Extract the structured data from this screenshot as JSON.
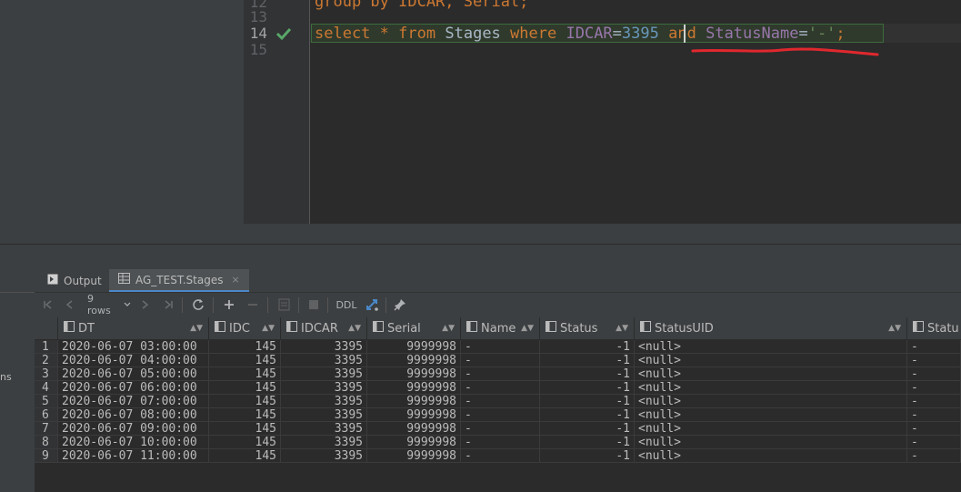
{
  "editor": {
    "line_numbers": [
      "12",
      "13",
      "14",
      "15"
    ],
    "line12_text": "group by IDCAR, Serial;",
    "line14": {
      "kw_select": "select",
      "star": "*",
      "kw_from": "from",
      "table": "Stages",
      "kw_where": "where",
      "col1": "IDCAR",
      "eq1": "=",
      "val1": "3395",
      "kw_and": "and",
      "col2": "StatusName",
      "eq2": "=",
      "val2": "'-'",
      "semi": ";"
    },
    "status_icon": "checkmark-icon",
    "annotation_color": "#e0282e"
  },
  "panel": {
    "tabs": [
      {
        "label": "Output",
        "icon": "output-icon"
      },
      {
        "label": "AG_TEST.Stages",
        "icon": "table-icon",
        "close": "×"
      }
    ],
    "left_partial_text": "ns"
  },
  "toolbar": {
    "rows_label": "9 rows",
    "ddl_label": "DDL"
  },
  "grid": {
    "columns": [
      "DT",
      "IDC",
      "IDCAR",
      "Serial",
      "Name",
      "Status",
      "StatusUID",
      "Statu"
    ],
    "rows": [
      [
        "1",
        "2020-06-07 03:00:00",
        "145",
        "3395",
        "9999998",
        "-",
        "-1",
        "<null>",
        "-"
      ],
      [
        "2",
        "2020-06-07 04:00:00",
        "145",
        "3395",
        "9999998",
        "-",
        "-1",
        "<null>",
        "-"
      ],
      [
        "3",
        "2020-06-07 05:00:00",
        "145",
        "3395",
        "9999998",
        "-",
        "-1",
        "<null>",
        "-"
      ],
      [
        "4",
        "2020-06-07 06:00:00",
        "145",
        "3395",
        "9999998",
        "-",
        "-1",
        "<null>",
        "-"
      ],
      [
        "5",
        "2020-06-07 07:00:00",
        "145",
        "3395",
        "9999998",
        "-",
        "-1",
        "<null>",
        "-"
      ],
      [
        "6",
        "2020-06-07 08:00:00",
        "145",
        "3395",
        "9999998",
        "-",
        "-1",
        "<null>",
        "-"
      ],
      [
        "7",
        "2020-06-07 09:00:00",
        "145",
        "3395",
        "9999998",
        "-",
        "-1",
        "<null>",
        "-"
      ],
      [
        "8",
        "2020-06-07 10:00:00",
        "145",
        "3395",
        "9999998",
        "-",
        "-1",
        "<null>",
        "-"
      ],
      [
        "9",
        "2020-06-07 11:00:00",
        "145",
        "3395",
        "9999998",
        "-",
        "-1",
        "<null>",
        "-"
      ]
    ]
  }
}
